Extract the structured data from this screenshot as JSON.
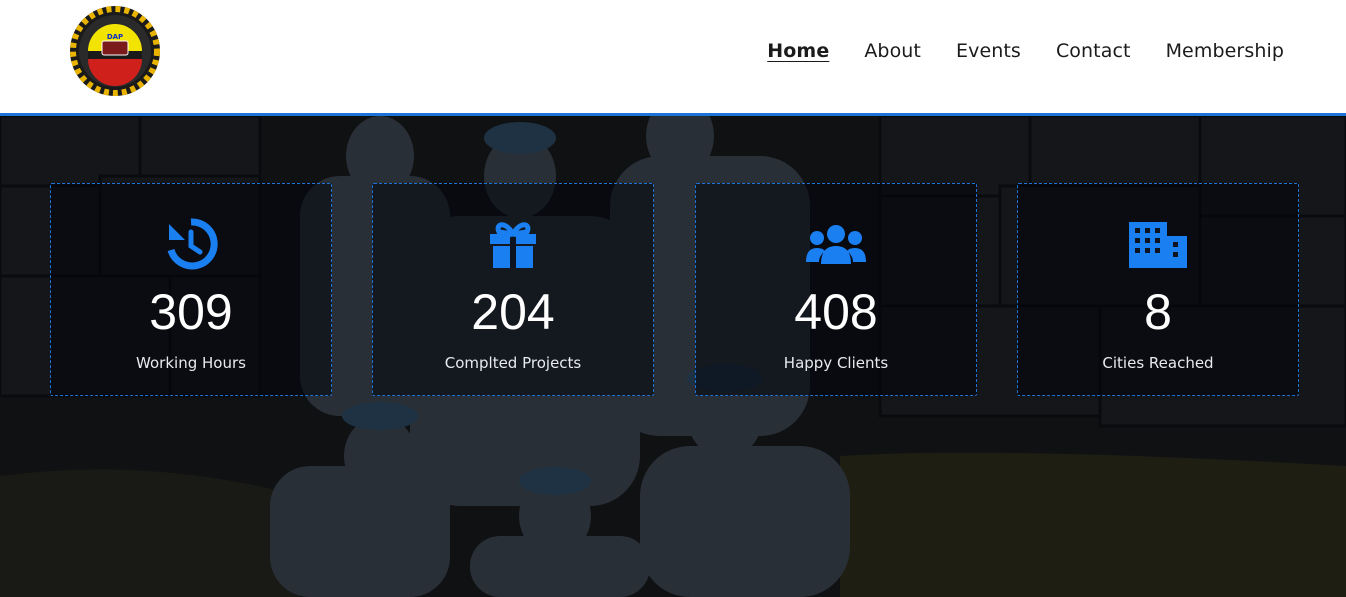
{
  "header": {
    "logo_icon": "party-logo-icon",
    "logo_text": "DAP",
    "nav": [
      {
        "label": "Home",
        "active": true
      },
      {
        "label": "About",
        "active": false
      },
      {
        "label": "Events",
        "active": false
      },
      {
        "label": "Contact",
        "active": false
      },
      {
        "label": "Membership",
        "active": false
      }
    ]
  },
  "stats": [
    {
      "icon": "history-icon",
      "value": "309",
      "label": "Working Hours"
    },
    {
      "icon": "gift-icon",
      "value": "204",
      "label": "Complted Projects"
    },
    {
      "icon": "users-icon",
      "value": "408",
      "label": "Happy Clients"
    },
    {
      "icon": "building-icon",
      "value": "8",
      "label": "Cities Reached"
    }
  ],
  "colors": {
    "accent": "#1e73d8",
    "icon": "#1a7ff0",
    "header_bg": "#ffffff",
    "text_light": "#ffffff"
  }
}
